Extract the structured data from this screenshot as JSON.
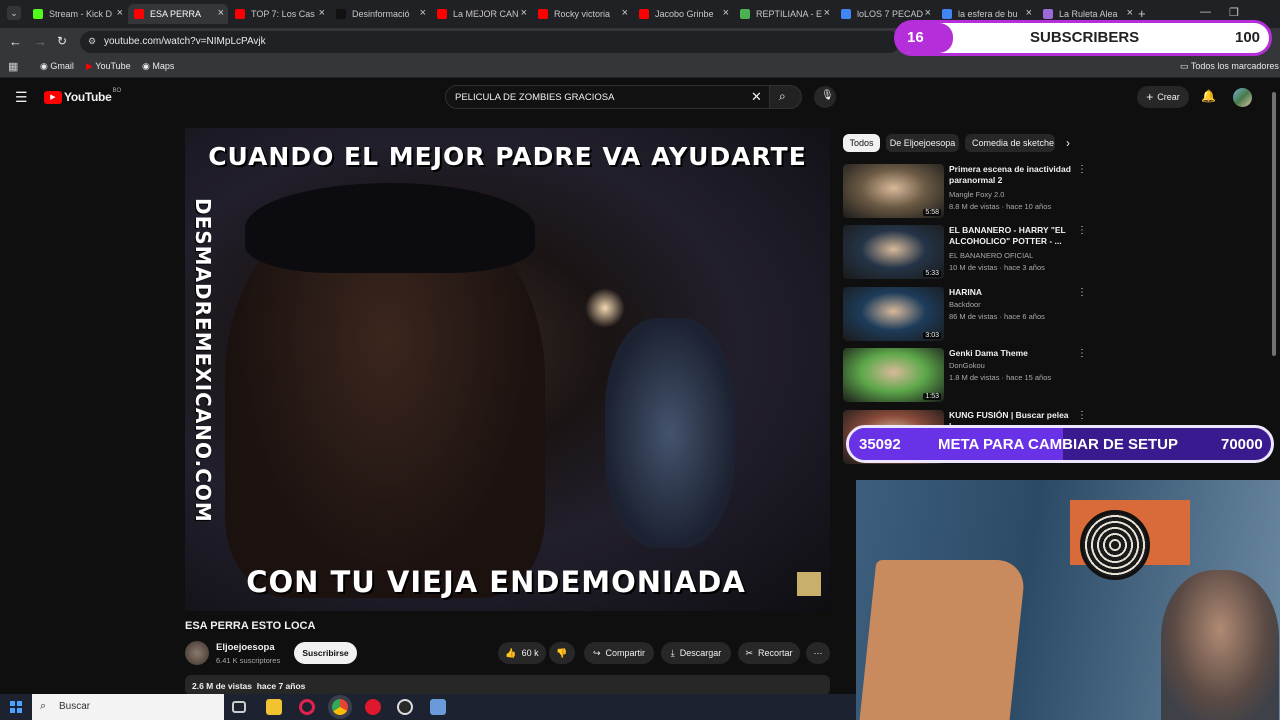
{
  "tabs": [
    {
      "label": "Stream - Kick D",
      "color": "#53fc18"
    },
    {
      "label": "ESA PERRA",
      "color": "#ff0000",
      "active": true
    },
    {
      "label": "TOP 7: Los Cas",
      "color": "#ff0000"
    },
    {
      "label": "Desinformació",
      "color": "#111111"
    },
    {
      "label": "La MEJOR CAN",
      "color": "#ff0000"
    },
    {
      "label": "Rocky victoria",
      "color": "#ff0000"
    },
    {
      "label": "Jacobo Grinbe",
      "color": "#ff0000"
    },
    {
      "label": "REPTILIANA - E",
      "color": "#4caf50"
    },
    {
      "label": "loLOS 7 PECAD",
      "color": "#4285f4"
    },
    {
      "label": "la esfera de bu",
      "color": "#4285f4"
    },
    {
      "label": "La Ruleta Alea",
      "color": "#9c6ad6"
    }
  ],
  "browser": {
    "url": "youtube.com/watch?v=NIMpLcPAvjk",
    "bookmarks": [
      "Gmail",
      "YouTube",
      "Maps"
    ],
    "all_bookmarks": "Todos los marcadores"
  },
  "youtube": {
    "logo_text": "YouTube",
    "region": "BO",
    "search_value": "PELICULA DE ZOMBIES GRACIOSA",
    "create_label": "Crear"
  },
  "video": {
    "top_caption": "CUANDO EL MEJOR PADRE VA AYUDARTE",
    "side_watermark": "DESMADREMEXICANO.COM",
    "bottom_caption": "CON TU VIEJA ENDEMONIADA",
    "title": "ESA PERRA ESTO LOCA",
    "channel": "Eljoejoesopa",
    "subscribers": "6.41 K suscriptores",
    "subscribe_label": "Suscribirse",
    "likes": "60 k",
    "share_label": "Compartir",
    "download_label": "Descargar",
    "clip_label": "Recortar",
    "views_line": "2.6 M de vistas  hace 7 años"
  },
  "chips": [
    "Todos",
    "De Eljoejoesopa",
    "Comedia de sketche"
  ],
  "recommendations": [
    {
      "title": "Primera escena de inactividad paranormal 2",
      "channel": "Mangle Foxy 2.0",
      "meta": "8.8 M de vistas · hace 10 años",
      "duration": "5:58",
      "color": "#6b5a44"
    },
    {
      "title": "EL BANANERO - HARRY \"EL ALCOHOLICO\" POTTER - ...",
      "channel": "EL BANANERO OFICIAL",
      "meta": "10 M de vistas · hace 3 años",
      "duration": "5:33",
      "color": "#243447"
    },
    {
      "title": "HARINA",
      "channel": "Backdoor",
      "meta": "86 M de vistas · hace 6 años",
      "duration": "3:03",
      "color": "#1d3c5a"
    },
    {
      "title": "Genki Dama Theme",
      "channel": "DonGokou",
      "meta": "1.8 M de vistas · hace 15 años",
      "duration": "1:53",
      "color": "#5da84a"
    },
    {
      "title": "KUNG FUSIÓN | Buscar pelea |",
      "channel": "",
      "meta": "",
      "duration": "",
      "color": "#8a4b3a"
    }
  ],
  "overlay": {
    "subs_count": "16",
    "subs_label": "SUBSCRIBERS",
    "subs_goal": "100",
    "goal_current": "35092",
    "goal_label": "META PARA CAMBIAR DE SETUP",
    "goal_target": "70000"
  },
  "taskbar": {
    "search_placeholder": "Buscar"
  }
}
